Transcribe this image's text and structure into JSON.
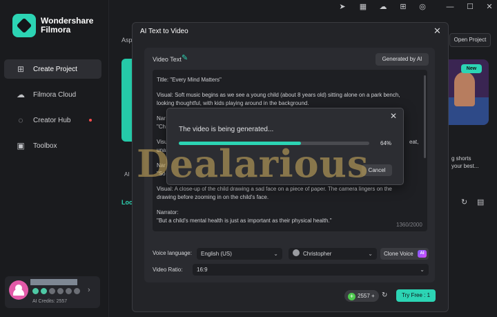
{
  "app": {
    "name_line1": "Wondershare",
    "name_line2": "Filmora"
  },
  "sidebar": {
    "items": [
      {
        "label": "Create Project",
        "icon": "plus-square-icon",
        "active": true
      },
      {
        "label": "Filmora Cloud",
        "icon": "cloud-icon"
      },
      {
        "label": "Creator Hub",
        "icon": "bulb-icon",
        "dot": true
      },
      {
        "label": "Toolbox",
        "icon": "toolbox-icon"
      }
    ]
  },
  "user": {
    "ai_credits": "AI Credits: 2557"
  },
  "background": {
    "aspect_label": "Asp",
    "open_project": "Open Project",
    "ai_label": "AI",
    "local_label": "Loc",
    "new_badge": "New",
    "promo_line1": "g shorts",
    "promo_line2": "your best..."
  },
  "dialog": {
    "title": "AI Text to Video",
    "video_text_label": "Video Text",
    "generated_by_ai": "Generated by AI",
    "lines": [
      "Title: \"Every Mind Matters\"",
      "Visual: Soft music begins as we see a young child (about 8 years old) sitting alone on a park bench,",
      "looking thoughtful, with kids playing around in the background.",
      "Nar",
      "\"Ch",
      "Visu",
      "una",
      "Nar",
      "\"So",
      "Visual: A close-up of the child drawing a sad face on a piece of paper. The camera lingers on the",
      "drawing before zooming in on the child's face.",
      "Narrator:",
      "\"But a child's mental health is just as important as their physical health.\""
    ],
    "right_fragment_1": "eat,",
    "char_count": "1360/2000",
    "voice_language_label": "Voice language:",
    "voice_language_value": "English (US)",
    "voice_name": "Christopher",
    "clone_voice": "Clone Voice",
    "ai_tag": "AI",
    "video_ratio_label": "Video Ratio:",
    "video_ratio_value": "16:9",
    "credits": "2557",
    "try_free": "Try Free : 1"
  },
  "progress": {
    "message": "The video is being generated...",
    "percent_label": "64%",
    "value": 0.64,
    "cancel": "Cancel"
  },
  "watermark": "Dealarious",
  "colors": {
    "accent": "#2cd4b4",
    "background": "#1b1c1f",
    "dialog": "#232428"
  }
}
